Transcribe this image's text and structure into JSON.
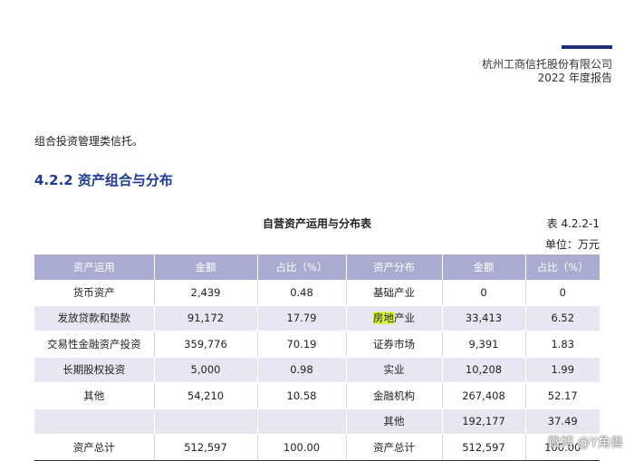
{
  "header": {
    "company_line1": "杭州工商信托股份有限公司",
    "company_line2": "2022 年度报告"
  },
  "intro_text": "组合投资管理类信托。",
  "section_title": "4.2.2 资产组合与分布",
  "table": {
    "title": "自营资产运用与分布表",
    "number": "表 4.2.2-1",
    "unit": "单位：万元",
    "headers": [
      "资产运用",
      "金额",
      "占比（%）",
      "资产分布",
      "金额",
      "占比（%）"
    ],
    "rows": [
      [
        "货币资产",
        "2,439",
        "0.48",
        "基础产业",
        "0",
        "0"
      ],
      [
        "发放贷款和垫款",
        "91,172",
        "17.79",
        "房地产业",
        "33,413",
        "6.52"
      ],
      [
        "交易性金融资产投资",
        "359,776",
        "70.19",
        "证券市场",
        "9,391",
        "1.83"
      ],
      [
        "长期股权投资",
        "5,000",
        "0.98",
        "实业",
        "10,208",
        "1.99"
      ],
      [
        "其他",
        "54,210",
        "10.58",
        "金融机构",
        "267,408",
        "52.17"
      ],
      [
        "",
        "",
        "",
        "其他",
        "192,177",
        "37.49"
      ],
      [
        "资产总计",
        "512,597",
        "100.00",
        "资产总计",
        "512,597",
        "100.00"
      ]
    ],
    "highlight_part": "房地",
    "highlight_rest": "产业"
  },
  "watermark": "微博 @Y角兽",
  "colors": {
    "accent": "#1f3a93",
    "header_bg": "#a9acd0",
    "stripe": "#e6e7f2",
    "highlight": "#d8f04a"
  }
}
